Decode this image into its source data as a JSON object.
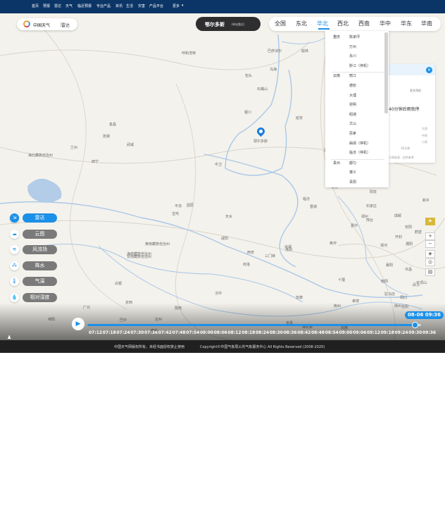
{
  "topnav": {
    "items": [
      "首页",
      "预报",
      "雷达",
      "天气",
      "临近预报",
      "专业产品",
      "资讯",
      "生活",
      "灾害",
      "产品平台",
      "更多"
    ]
  },
  "logo": {
    "title": "中国天气",
    "subtitle": "雷达"
  },
  "location": {
    "name": "鄂尔多斯",
    "hint": "（单站雷达）"
  },
  "region_tabs": {
    "tabs": [
      "全国",
      "东北",
      "华北",
      "西北",
      "西南",
      "华中",
      "华东",
      "华南"
    ],
    "active": "华北"
  },
  "city_dropdown": {
    "groups": [
      {
        "province": "重庆",
        "cities": [
          "陈家坪",
          "万州",
          "永川",
          "黔江（停机）"
        ]
      },
      {
        "province": "云南",
        "cities": [
          "丽江",
          "德钦",
          "大理",
          "昆明",
          "昭通",
          "文山",
          "思茅",
          "曲靖（停机）",
          "临沧（停机）"
        ]
      },
      {
        "province": "贵州",
        "cities": [
          "都匀",
          "遵义",
          "贵阳"
        ]
      }
    ]
  },
  "info_panel": {
    "more": "更多预报",
    "forecast": "40分钟后雨就停",
    "levels": [
      "大雨",
      "中雨",
      "小雨"
    ],
    "time": "30分钟",
    "legend": "小雨有雨 · 仅供参考"
  },
  "layers": [
    {
      "label": "雷达",
      "icon": "radar-icon",
      "glyph": "⇲",
      "active": true
    },
    {
      "label": "云图",
      "icon": "cloud-icon",
      "glyph": "☁",
      "active": false
    },
    {
      "label": "风流场",
      "icon": "wind-icon",
      "glyph": "≋",
      "active": false
    },
    {
      "label": "降水",
      "icon": "rain-icon",
      "glyph": "⁂",
      "active": false
    },
    {
      "label": "气温",
      "icon": "thermometer-icon",
      "glyph": "🌡",
      "active": false
    },
    {
      "label": "相对湿度",
      "icon": "humidity-icon",
      "glyph": "💧",
      "active": false
    }
  ],
  "map_labels": [
    {
      "text": "呼和浩特"
    },
    {
      "text": "乌海"
    },
    {
      "text": "石嘴山"
    },
    {
      "text": "银川"
    },
    {
      "text": "中卫"
    },
    {
      "text": "固原"
    },
    {
      "text": "兰州"
    },
    {
      "text": "西宁"
    },
    {
      "text": "天水"
    },
    {
      "text": "平凉"
    },
    {
      "text": "延安"
    },
    {
      "text": "榆林"
    },
    {
      "text": "宝鸡"
    },
    {
      "text": "西安"
    },
    {
      "text": "咸阳"
    },
    {
      "text": "商洛"
    },
    {
      "text": "汉中"
    },
    {
      "text": "安康"
    },
    {
      "text": "十堰"
    },
    {
      "text": "南阳"
    },
    {
      "text": "洛阳"
    },
    {
      "text": "三门峡"
    },
    {
      "text": "运城"
    },
    {
      "text": "临汾"
    },
    {
      "text": "长治"
    },
    {
      "text": "晋城"
    },
    {
      "text": "焦作"
    },
    {
      "text": "郑州"
    },
    {
      "text": "开封"
    },
    {
      "text": "许昌"
    },
    {
      "text": "平顶山"
    },
    {
      "text": "周口"
    },
    {
      "text": "驻马店"
    },
    {
      "text": "信阳"
    },
    {
      "text": "武汉"
    },
    {
      "text": "荆州"
    },
    {
      "text": "宜昌"
    },
    {
      "text": "襄阳"
    },
    {
      "text": "甘南藏族自治州"
    },
    {
      "text": "海北藏族自治州"
    },
    {
      "text": "海南藏族自治州"
    },
    {
      "text": "黄南藏族自治州"
    },
    {
      "text": "张掖"
    },
    {
      "text": "武威"
    },
    {
      "text": "金昌"
    },
    {
      "text": "白银"
    },
    {
      "text": "定西"
    },
    {
      "text": "陇南"
    },
    {
      "text": "广元"
    },
    {
      "text": "巴中"
    },
    {
      "text": "达州"
    },
    {
      "text": "绵阳"
    },
    {
      "text": "南充"
    },
    {
      "text": "巴彦淖尔"
    },
    {
      "text": "包头"
    },
    {
      "text": "鄂尔多斯"
    },
    {
      "text": "吕梁"
    },
    {
      "text": "太原"
    },
    {
      "text": "晋中"
    },
    {
      "text": "阳泉"
    },
    {
      "text": "石家庄"
    },
    {
      "text": "邢台"
    },
    {
      "text": "邯郸"
    },
    {
      "text": "安阳"
    },
    {
      "text": "鹤壁"
    },
    {
      "text": "新乡"
    },
    {
      "text": "濮阳"
    },
    {
      "text": "漯河"
    },
    {
      "text": "随州"
    },
    {
      "text": "孝感"
    },
    {
      "text": "恩施"
    },
    {
      "text": "神农架"
    }
  ],
  "timeline": {
    "current": "08-06 09:36",
    "progress": 1.0,
    "ticks": [
      "07:12",
      "07:18",
      "07:24",
      "07:30",
      "07:36",
      "07:42",
      "07:48",
      "07:54",
      "08:00",
      "08:06",
      "08:12",
      "08:18",
      "08:24",
      "08:30",
      "08:36",
      "08:42",
      "08:48",
      "08:54",
      "09:00",
      "09:06",
      "09:12",
      "09:18",
      "09:24",
      "09:30",
      "09:36"
    ]
  },
  "footer": {
    "left": "中国天气网版权所有，未经书面授权禁止使用",
    "right": "Copyright©中国气象局公共气象服务中心 All Rights Reserved (2008-2020)"
  },
  "colors": {
    "accent": "#1b90e8",
    "nav": "#0b3566",
    "map_bg": "#f4f2ec",
    "river": "#a9c8e8"
  }
}
